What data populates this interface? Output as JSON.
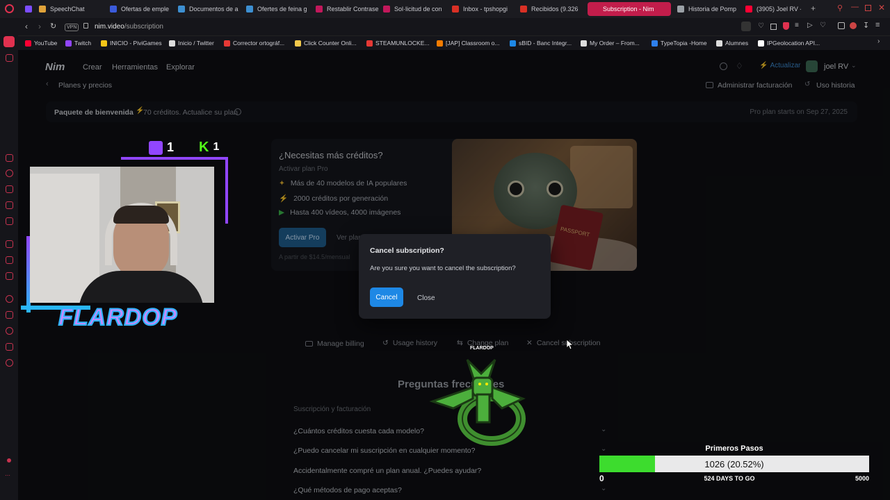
{
  "browser": {
    "tabs": [
      {
        "label": "SpeechChat",
        "color": "#e0a33a"
      },
      {
        "label": "Ofertas de emple",
        "color": "#3b5bdb"
      },
      {
        "label": "Documentos de a",
        "color": "#3d8fd1"
      },
      {
        "label": "Ofertes de feina g",
        "color": "#3d8fd1"
      },
      {
        "label": "Restablir Contrase",
        "color": "#c2185b"
      },
      {
        "label": "Sol·licitud de con",
        "color": "#c2185b"
      },
      {
        "label": "Inbox - tpshopgi",
        "color": "#d93025"
      },
      {
        "label": "Recibidos (9.326",
        "color": "#d93025"
      },
      {
        "label": "Subscription - Nim",
        "color": "#c21d4b"
      },
      {
        "label": "Historia de Pomp",
        "color": "#9aa0a6"
      },
      {
        "label": "(3905) Joel RV -",
        "color": "#ff0033"
      }
    ],
    "vpn": "VPN",
    "url_host": "nim.video",
    "url_path": "/subscription",
    "bookmarks": [
      {
        "label": "YouTube",
        "color": "#ff0033"
      },
      {
        "label": "Twitch",
        "color": "#9146ff"
      },
      {
        "label": "INICIO - PiviGames",
        "color": "#f5c518"
      },
      {
        "label": "Inicio / Twitter",
        "color": "#dddddd"
      },
      {
        "label": "Corrector ortográf...",
        "color": "#e53935"
      },
      {
        "label": "Click Counter Onli...",
        "color": "#f2c94c"
      },
      {
        "label": "STEAMUNLOCKE...",
        "color": "#e53935"
      },
      {
        "label": "[JAP] Classroom o...",
        "color": "#f57c00"
      },
      {
        "label": "sBID - Banc Integr...",
        "color": "#1e88e5"
      },
      {
        "label": "My Order – From...",
        "color": "#dddddd"
      },
      {
        "label": "TypeTopia -Home",
        "color": "#2f80ed"
      },
      {
        "label": "Alumnes",
        "color": "#dddddd"
      },
      {
        "label": "IPGeolocation API...",
        "color": "#ffffff"
      }
    ]
  },
  "app": {
    "logo": "Nim",
    "nav": {
      "create": "Crear",
      "tools": "Herramientas",
      "explore": "Explorar"
    },
    "upgrade": "Actualizar",
    "user": "joel RV",
    "breadcrumb": "Planes y precios",
    "manage_billing": "Administrar facturación",
    "usage_history": "Uso historia",
    "welcome": {
      "title": "Paquete de bienvenida",
      "credits": "70 créditos. Actualice su plan",
      "pro_starts": "Pro plan starts on Sep 27, 2025"
    },
    "promo": {
      "title": "¿Necesitas más créditos?",
      "subtitle": "Activar plan Pro",
      "features": [
        "Más de 40 modelos de IA populares",
        "2000 créditos por generación",
        "Hasta 400 vídeos, 4000 imágenes"
      ],
      "activate": "Activar Pro",
      "see_plans": "Ver plan",
      "price": "A partir de $14.5/mensual",
      "image_text": "PASSPORT"
    },
    "actions": {
      "manage_billing": "Manage billing",
      "usage_history": "Usage history",
      "change_plan": "Change plan",
      "cancel_subscription": "Cancel subscription"
    },
    "faq": {
      "title": "Preguntas frecuentes",
      "section": "Suscripción y facturación",
      "questions": [
        "¿Cuántos créditos cuesta cada modelo?",
        "¿Puedo cancelar mi suscripción en cualquier momento?",
        "Accidentalmente compré un plan anual. ¿Puedes ayudar?",
        "¿Qué métodos de pago aceptas?"
      ]
    },
    "modal": {
      "title": "Cancel subscription?",
      "message": "Are you sure you want to cancel the subscription?",
      "confirm": "Cancel",
      "close": "Close"
    }
  },
  "stream": {
    "twitch_count": "1",
    "kick_count": "1",
    "streamer_name": "FLARDOP",
    "sprite_tag": "FLARDOP",
    "goal": {
      "title": "Primeros Pasos",
      "value_text": "1026 (20.52%)",
      "fraction": 0.2052,
      "min": "0",
      "days": "524 DAYS TO GO",
      "max": "5000"
    }
  },
  "colors": {
    "accent_blue": "#1e88e5",
    "tab_active": "#c21d4b",
    "goal_green": "#3ddc2e"
  }
}
